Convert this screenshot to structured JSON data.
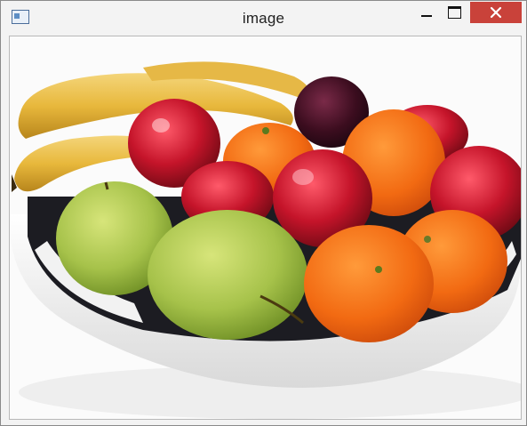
{
  "window": {
    "title": "image"
  },
  "controls": {
    "minimize_icon": "minimize-icon",
    "maximize_icon": "maximize-icon",
    "close_icon": "close-icon"
  },
  "colors": {
    "close_button": "#c9423a",
    "titlebar": "#f3f3f3"
  }
}
